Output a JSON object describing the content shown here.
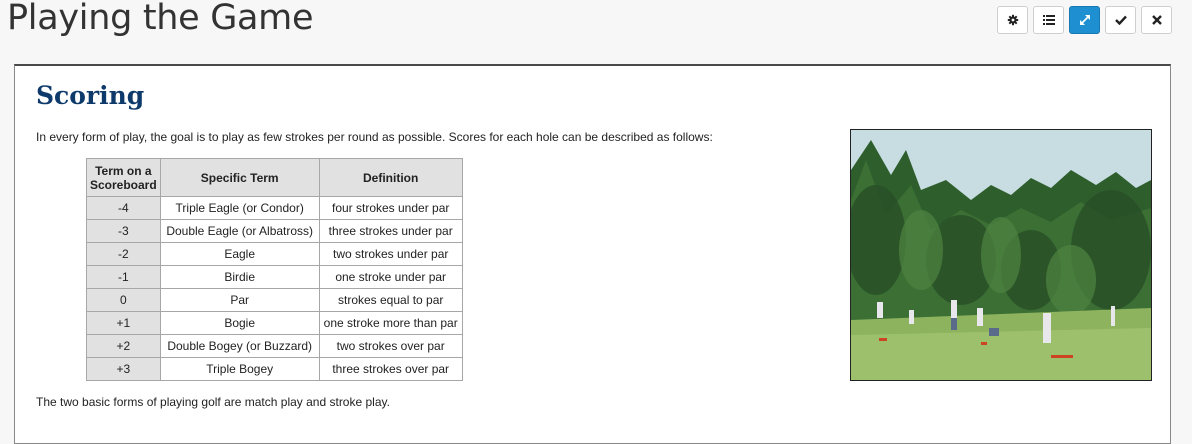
{
  "page": {
    "title": "Playing the Game"
  },
  "toolbar": {
    "buttons": [
      {
        "icon": "gear-icon",
        "active": false
      },
      {
        "icon": "list-icon",
        "active": false
      },
      {
        "icon": "expand-icon",
        "active": true
      },
      {
        "icon": "check-icon",
        "active": false
      },
      {
        "icon": "close-icon",
        "active": false
      }
    ],
    "active_color": "#1e8fd0"
  },
  "content": {
    "heading": "Scoring",
    "intro": "In every form of play, the goal is to play as few strokes per round as possible. Scores for each hole can be described as follows:",
    "outro": "The two basic forms of playing golf are match play and stroke play.",
    "table": {
      "headers": [
        "Term on a Scoreboard",
        "Specific Term",
        "Definition"
      ],
      "rows": [
        [
          "-4",
          "Triple Eagle (or Condor)",
          "four strokes under par"
        ],
        [
          "-3",
          "Double Eagle (or Albatross)",
          "three strokes under par"
        ],
        [
          "-2",
          "Eagle",
          "two strokes under par"
        ],
        [
          "-1",
          "Birdie",
          "one stroke under par"
        ],
        [
          "0",
          "Par",
          "strokes equal to par"
        ],
        [
          "+1",
          "Bogie",
          "one stroke more than par"
        ],
        [
          "+2",
          "Double Bogey (or Buzzard)",
          "two strokes over par"
        ],
        [
          "+3",
          "Triple Bogey",
          "three strokes over par"
        ]
      ]
    }
  },
  "colors": {
    "heading": "#0e3a6b",
    "table_header_bg": "#e1e1e1"
  }
}
